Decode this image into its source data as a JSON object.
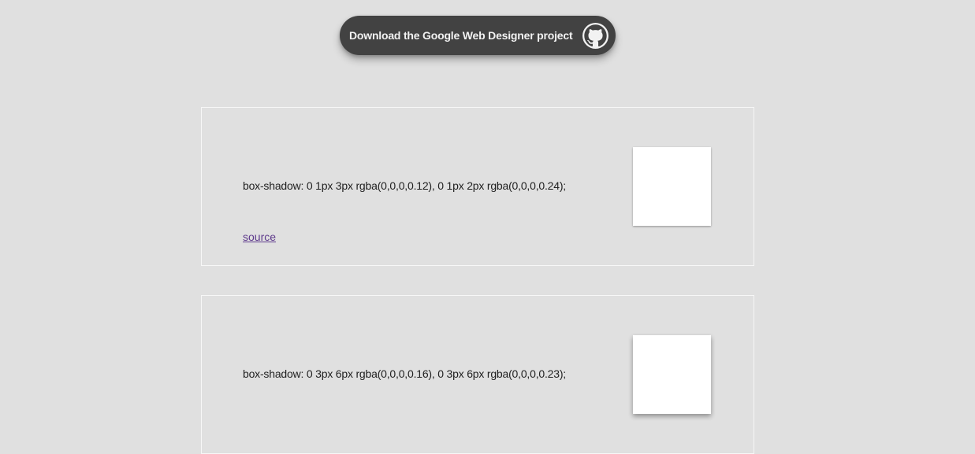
{
  "header": {
    "download_label": "Download the Google Web Designer project",
    "icon": "github-icon",
    "pill_color": "#424242"
  },
  "cards": [
    {
      "css_text": "box-shadow: 0 1px 3px rgba(0,0,0,0.12), 0 1px 2px rgba(0,0,0,0.24);",
      "link_label": "source"
    },
    {
      "css_text": "box-shadow: 0 3px 6px rgba(0,0,0,0.16), 0 3px 6px rgba(0,0,0,0.23);"
    }
  ],
  "colors": {
    "background": "#e0e0e0",
    "link": "#5e3a8c",
    "box": "#ffffff"
  }
}
